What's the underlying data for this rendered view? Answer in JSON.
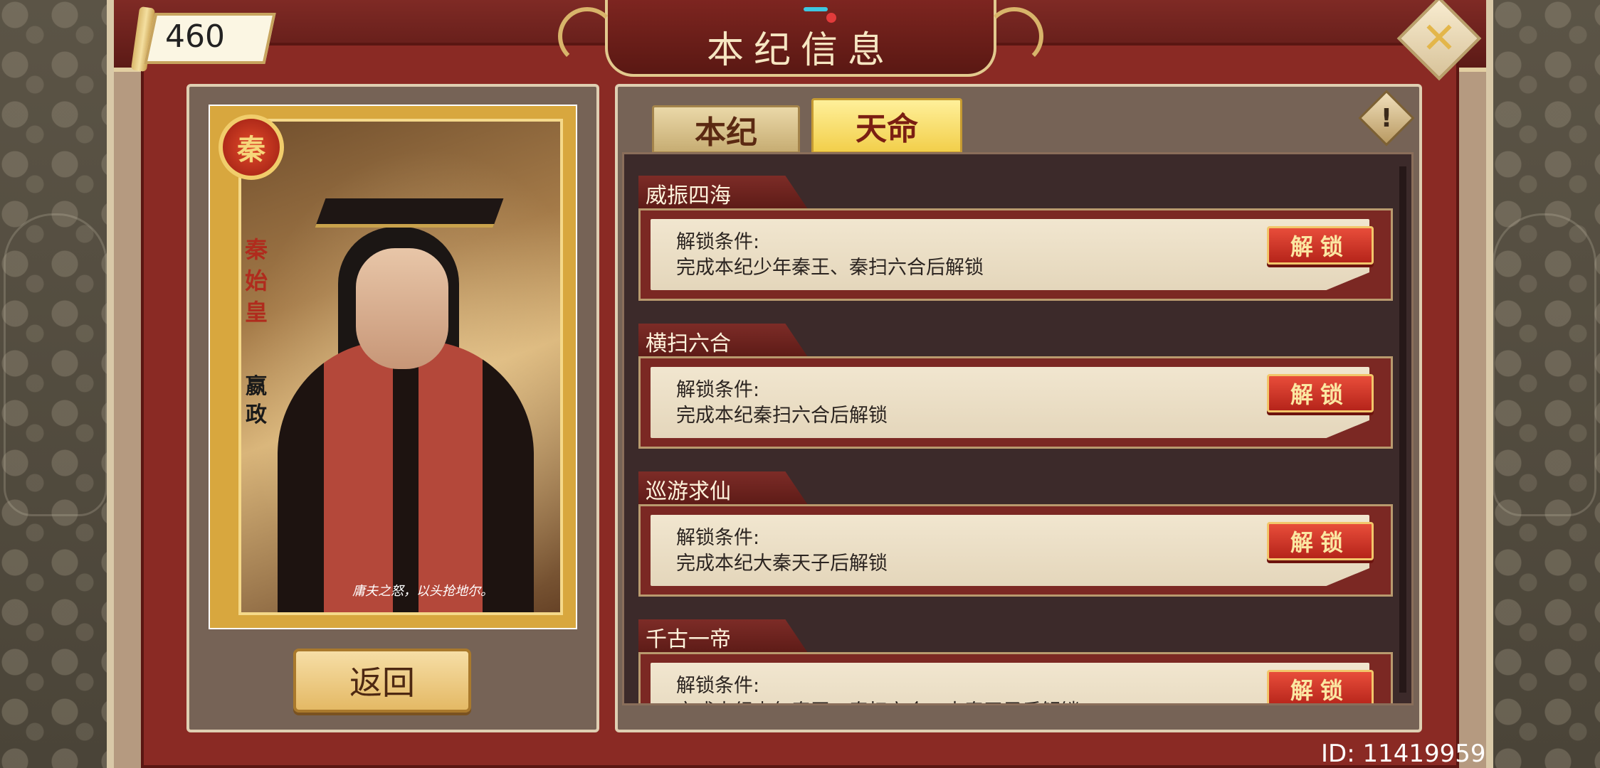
{
  "header": {
    "title": "本纪信息",
    "score": "460"
  },
  "hero": {
    "seal_char": "秦",
    "title_vertical": "秦始皇",
    "name_vertical": "嬴政",
    "quote": "庸夫之怒，以头抢地尔。"
  },
  "buttons": {
    "back": "返回",
    "close_icon": "close-x-icon",
    "info_icon": "exclamation-icon"
  },
  "tabs": [
    {
      "label": "本纪",
      "active": false
    },
    {
      "label": "天命",
      "active": true
    }
  ],
  "entries": [
    {
      "title": "威振四海",
      "cond_label": "解锁条件:",
      "desc": "完成本纪少年秦王、秦扫六合后解锁",
      "button": "解锁"
    },
    {
      "title": "横扫六合",
      "cond_label": "解锁条件:",
      "desc": "完成本纪秦扫六合后解锁",
      "button": "解锁"
    },
    {
      "title": "巡游求仙",
      "cond_label": "解锁条件:",
      "desc": "完成本纪大秦天子后解锁",
      "button": "解锁"
    },
    {
      "title": "千古一帝",
      "cond_label": "解锁条件:",
      "desc": "完成本纪少年秦王、秦扫六合、大秦天子后解锁",
      "button": "解锁"
    }
  ],
  "footer": {
    "user_id": "ID: 11419959"
  },
  "colors": {
    "frame_red": "#8a2a24",
    "tab_active": "#f2cf4b",
    "unlock_red": "#b5241a",
    "gold": "#d8a73e"
  }
}
